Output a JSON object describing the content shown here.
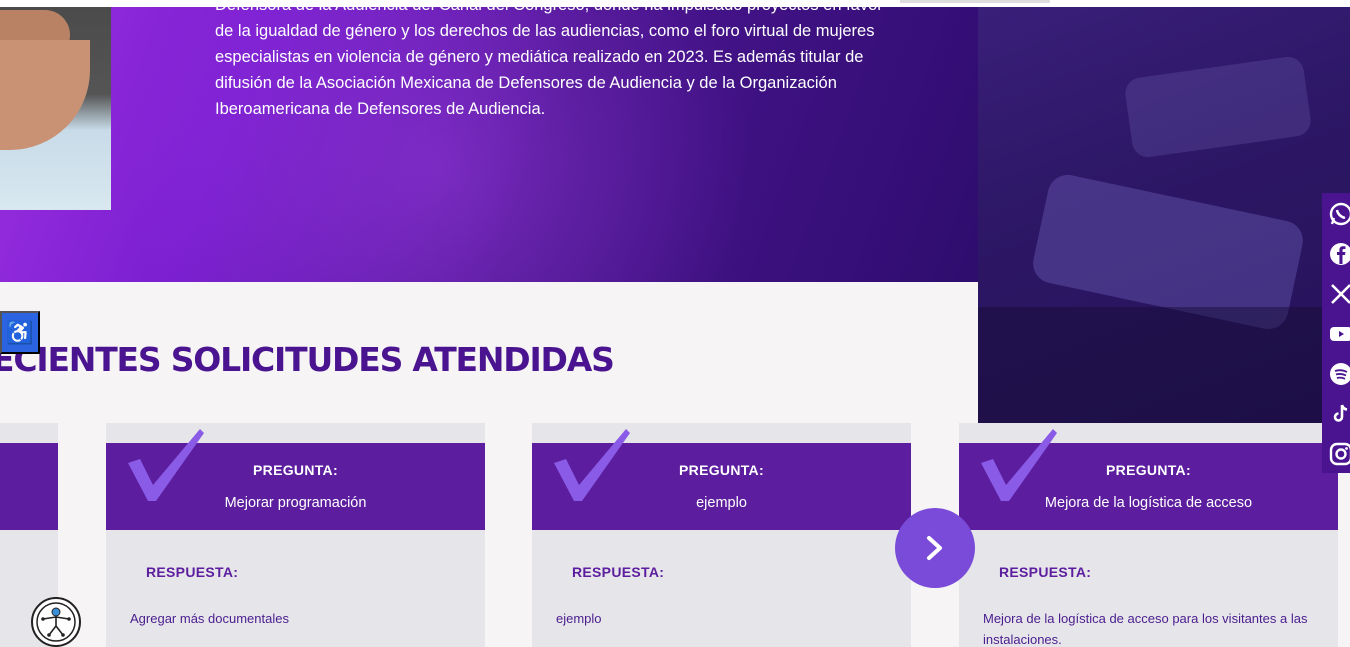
{
  "bio": {
    "text": "Defensora de la Audiencia del Canal del Congreso, donde ha impulsado proyectos en favor de la igualdad de género y los derechos de las audiencias, como el foro virtual de mujeres especialistas en violencia de género y mediática realizado en 2023. Es además titular de difusión de la Asociación Mexicana de Defensores de Audiencia y de la Organización Iberoamericana de Defensores de Audiencia."
  },
  "section": {
    "title": "ECIENTES SOLICITUDES ATENDIDAS"
  },
  "cards": [
    {
      "question_label": "PREGUNTA:",
      "question": "Mejorar programación",
      "answer_label": "RESPUESTA:",
      "answer": "Agregar más documentales"
    },
    {
      "question_label": "PREGUNTA:",
      "question": "ejemplo",
      "answer_label": "RESPUESTA:",
      "answer": "ejemplo"
    },
    {
      "question_label": "PREGUNTA:",
      "question": "Mejora de la logística de acceso",
      "answer_label": "RESPUESTA:",
      "answer": "Mejora de la logística de acceso para los visitantes a las instalaciones."
    }
  ],
  "accessibility": {
    "icon": "wheelchair-icon"
  },
  "carousel": {
    "next_icon": "chevron-right-icon"
  },
  "social": [
    "whatsapp-icon",
    "facebook-icon",
    "x-icon",
    "youtube-icon",
    "spotify-icon",
    "tiktok-icon",
    "instagram-icon"
  ],
  "colors": {
    "brand_purple": "#5c1d9e",
    "title_purple": "#4a1490",
    "accent_violet": "#7a4bd8",
    "a11y_blue": "#2b63e0"
  }
}
